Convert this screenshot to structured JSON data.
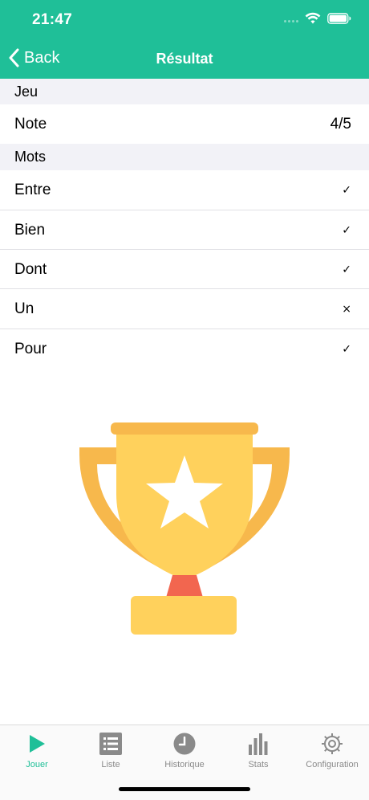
{
  "status_bar": {
    "time": "21:47"
  },
  "nav": {
    "back_label": "Back",
    "title": "Résultat"
  },
  "sections": {
    "game": {
      "header": "Jeu",
      "rows": [
        {
          "label": "Note",
          "value": "4/5"
        }
      ]
    },
    "words": {
      "header": "Mots",
      "rows": [
        {
          "label": "Entre",
          "mark": "✓"
        },
        {
          "label": "Bien",
          "mark": "✓"
        },
        {
          "label": "Dont",
          "mark": "✓"
        },
        {
          "label": "Un",
          "mark": "×"
        },
        {
          "label": "Pour",
          "mark": "✓"
        }
      ]
    }
  },
  "tabs": [
    {
      "label": "Jouer",
      "icon": "play-icon",
      "active": true
    },
    {
      "label": "Liste",
      "icon": "list-icon",
      "active": false
    },
    {
      "label": "Historique",
      "icon": "clock-icon",
      "active": false
    },
    {
      "label": "Stats",
      "icon": "bar-chart-icon",
      "active": false
    },
    {
      "label": "Configuration",
      "icon": "gear-icon",
      "active": false
    }
  ],
  "colors": {
    "accent": "#1fbf98",
    "trophy_cup": "#ffd15c",
    "trophy_handles": "#f7b84c",
    "trophy_neck": "#f2664f",
    "inactive_tab": "#8a8a8a"
  }
}
